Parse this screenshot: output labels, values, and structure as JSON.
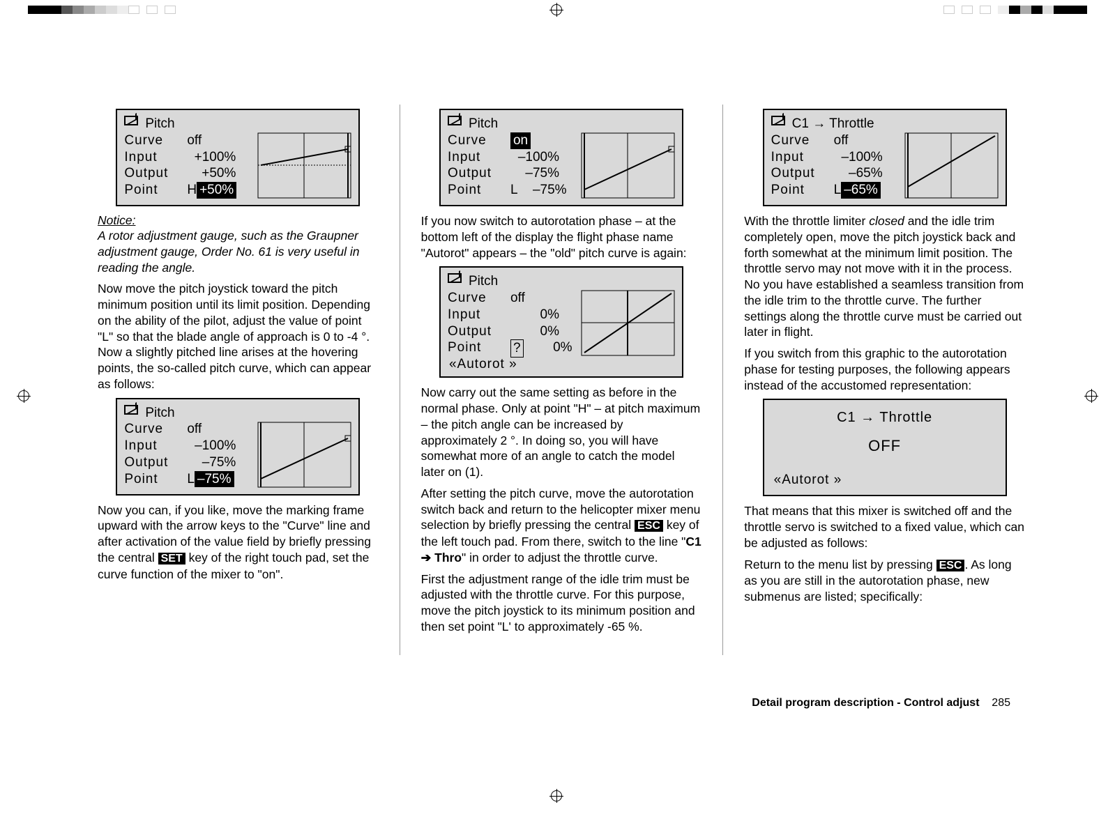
{
  "registration": {
    "topCenter": "⊕",
    "left": true,
    "right": true
  },
  "col1": {
    "lcd1": {
      "title": "Pitch",
      "curve_label": "Curve",
      "curve_val": "off",
      "input_label": "Input",
      "input_val": "+100%",
      "output_label": "Output",
      "output_val": "+50%",
      "point_label": "Point",
      "point_id": "H",
      "point_val": "+50%"
    },
    "notice_hdr": "Notice:",
    "notice_body": "A rotor adjustment gauge, such  as the Graupner adjustment gauge, Order No. 61 is very useful in reading the angle.",
    "p1": "Now move the pitch joystick toward the pitch minimum position until its limit position. Depending on the ability of the pilot, adjust the value of point \"L\" so that the blade angle of approach is 0 to -4 °. Now a slightly pitched line arises at the hovering points, the so-called pitch curve, which can appear as follows:",
    "lcd2": {
      "title": "Pitch",
      "curve_label": "Curve",
      "curve_val": "off",
      "input_label": "Input",
      "input_val": "–100%",
      "output_label": "Output",
      "output_val": "–75%",
      "point_label": "Point",
      "point_id": "L",
      "point_val": "–75%"
    },
    "p2a": "Now you can, if you like, move the marking frame upward with the arrow keys to the \"Curve\" line and after activation of the value field by briefly pressing the central ",
    "p2_key": "SET",
    "p2b": " key of the right touch pad, set the curve function of the mixer to \"on\"."
  },
  "col2": {
    "lcd1": {
      "title": "Pitch",
      "curve_label": "Curve",
      "curve_val": "on",
      "input_label": "Input",
      "input_val": "–100%",
      "output_label": "Output",
      "output_val": "–75%",
      "point_label": "Point",
      "point_id": "L",
      "point_val": "–75%"
    },
    "p1": "If you now switch to autorotation phase  – at the bottom left of the display the flight phase name \"Autorot\" appears – the \"old\" pitch curve is again:",
    "lcd2": {
      "title": "Pitch",
      "curve_label": "Curve",
      "curve_val": "off",
      "input_label": "Input",
      "input_val": "0%",
      "output_label": "Output",
      "output_val": "0%",
      "point_label": "Point",
      "point_id": "?",
      "point_val": "0%",
      "phase": "«Autorot  »"
    },
    "p2": "Now carry out the same setting as before in the normal phase. Only at point \"H\" – at pitch maximum – the pitch angle can be increased by approximately 2 °. In doing so, you will have somewhat more of an angle to catch the model later on (1).",
    "p3a": "After setting the pitch curve, move the autorotation switch back and return to the helicopter mixer menu selection by briefly pressing the central ",
    "p3_key": "ESC",
    "p3b": " key of the left touch pad. From there, switch to the line \"",
    "p3_bold": "C1 ➔ Thro",
    "p3c": "\" in order to adjust the throttle curve.",
    "p4": "First the adjustment range of the idle trim must be adjusted with the throttle curve. For this purpose, move the pitch joystick to its minimum position and then set point \"L' to approximately -65 %."
  },
  "col3": {
    "lcd1": {
      "title": "C1 → Throttle",
      "curve_label": "Curve",
      "curve_val": "off",
      "input_label": "Input",
      "input_val": "–100%",
      "output_label": "Output",
      "output_val": "–65%",
      "point_label": "Point",
      "point_id": "L",
      "point_val": "–65%"
    },
    "p1a": "With the throttle limiter ",
    "p1_ital": "closed",
    "p1b": " and the idle trim completely open, move the pitch joystick back and forth somewhat at the minimum limit position. The throttle servo may not move with it in the process. No you have established a seamless transition from the idle trim to the throttle curve. The further settings along the throttle curve must be carried out later in flight.",
    "p2": "If you switch from this graphic to the autorotation phase for testing purposes, the following appears instead of the accustomed representation:",
    "lcd_off": {
      "title": "C1 → Throttle",
      "val": "OFF",
      "phase": "«Autorot  »"
    },
    "p3": "That means that this mixer is switched off and the throttle servo is switched to a fixed value, which can be adjusted as follows:",
    "p4a": "Return to the menu list by pressing ",
    "p4_key": "ESC",
    "p4b": ". As long as you are still in the autorotation phase, new submenus are listed; specifically:"
  },
  "footer": {
    "title": "Detail program description - Control adjust",
    "page": "285"
  },
  "chart_data": [
    {
      "type": "line",
      "name": "col1-lcd1",
      "title": "Pitch curve, point H selected",
      "xlim": [
        -100,
        100
      ],
      "ylim": [
        -100,
        100
      ],
      "series": [
        {
          "name": "curve",
          "x": [
            -100,
            100
          ],
          "y": [
            0,
            50
          ]
        }
      ],
      "cursor_x": 100
    },
    {
      "type": "line",
      "name": "col1-lcd2",
      "title": "Pitch curve, point L selected",
      "xlim": [
        -100,
        100
      ],
      "ylim": [
        -100,
        100
      ],
      "series": [
        {
          "name": "curve",
          "x": [
            -100,
            100
          ],
          "y": [
            -75,
            50
          ]
        }
      ],
      "cursor_x": -100
    },
    {
      "type": "line",
      "name": "col2-lcd1",
      "title": "Pitch curve on, point L",
      "xlim": [
        -100,
        100
      ],
      "ylim": [
        -100,
        100
      ],
      "series": [
        {
          "name": "curve",
          "x": [
            -100,
            100
          ],
          "y": [
            -75,
            50
          ]
        }
      ],
      "cursor_x": -100
    },
    {
      "type": "line",
      "name": "col2-lcd2",
      "title": "Pitch curve Autorot, default",
      "xlim": [
        -100,
        100
      ],
      "ylim": [
        -100,
        100
      ],
      "series": [
        {
          "name": "curve",
          "x": [
            -100,
            100
          ],
          "y": [
            -100,
            100
          ]
        }
      ],
      "cursor_x": 0
    },
    {
      "type": "line",
      "name": "col3-lcd1",
      "title": "C1→Throttle curve, point L",
      "xlim": [
        -100,
        100
      ],
      "ylim": [
        -100,
        100
      ],
      "series": [
        {
          "name": "curve",
          "x": [
            -100,
            100
          ],
          "y": [
            -65,
            100
          ]
        }
      ],
      "cursor_x": -100
    }
  ]
}
